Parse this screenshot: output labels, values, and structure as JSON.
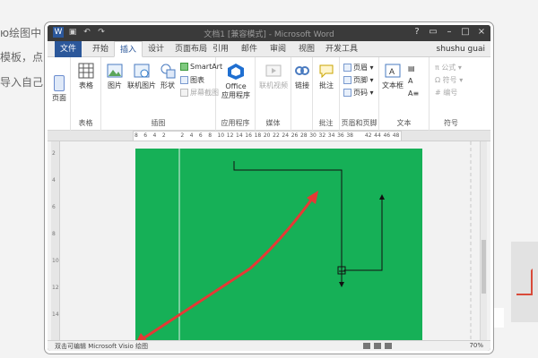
{
  "background": {
    "lines": [
      "ю绘图中",
      "模板，点",
      "导入自己"
    ]
  },
  "window": {
    "title": "文档1 [兼容模式] - Microsoft Word",
    "user": "shushu guai",
    "quick_access_icons": [
      "word-app-icon",
      "save-icon",
      "undo-icon",
      "redo-icon"
    ],
    "window_controls": [
      "help-icon",
      "ribbon-display-icon",
      "minimize-icon",
      "maximize-icon",
      "close-icon"
    ]
  },
  "tabs": [
    "文件",
    "开始",
    "插入",
    "设计",
    "页面布局",
    "引用",
    "邮件",
    "审阅",
    "视图",
    "开发工具"
  ],
  "active_tab": "插入",
  "ribbon": {
    "pages_label": "页面",
    "tables": {
      "button": "表格",
      "group": "表格"
    },
    "illustrations": {
      "picture": "图片",
      "online_picture": "联机图片",
      "shapes": "形状",
      "smartart": "SmartArt",
      "chart": "图表",
      "screenshot": "屏幕截图",
      "group": "插图"
    },
    "apps": {
      "button_line1": "Office",
      "button_line2": "应用程序",
      "group": "应用程序"
    },
    "media": {
      "button": "联机视频",
      "group": "媒体"
    },
    "links": {
      "button": "链接"
    },
    "comments": {
      "button": "批注",
      "group": "批注"
    },
    "header_footer": {
      "header": "页眉",
      "footer": "页脚",
      "page_number": "页码",
      "group": "页眉和页脚"
    },
    "text": {
      "textbox": "文本框",
      "group": "文本"
    },
    "symbols": {
      "equation": "公式",
      "symbol": "符号",
      "numbering": "编号",
      "group": "符号"
    }
  },
  "ruler_numbers": [
    "8",
    "6",
    "4",
    "2",
    "",
    "2",
    "4",
    "6",
    "8",
    "10",
    "12",
    "14",
    "16",
    "18",
    "20",
    "22",
    "24",
    "26",
    "28",
    "30",
    "32",
    "34",
    "36",
    "38",
    "",
    "42",
    "44",
    "46",
    "48"
  ],
  "status": {
    "message": "双击可编辑 Microsoft Visio 绘图",
    "zoom": "70%"
  },
  "colors": {
    "page_green": "#16b057",
    "annotation_red": "#e53935",
    "word_blue": "#2b579a"
  }
}
